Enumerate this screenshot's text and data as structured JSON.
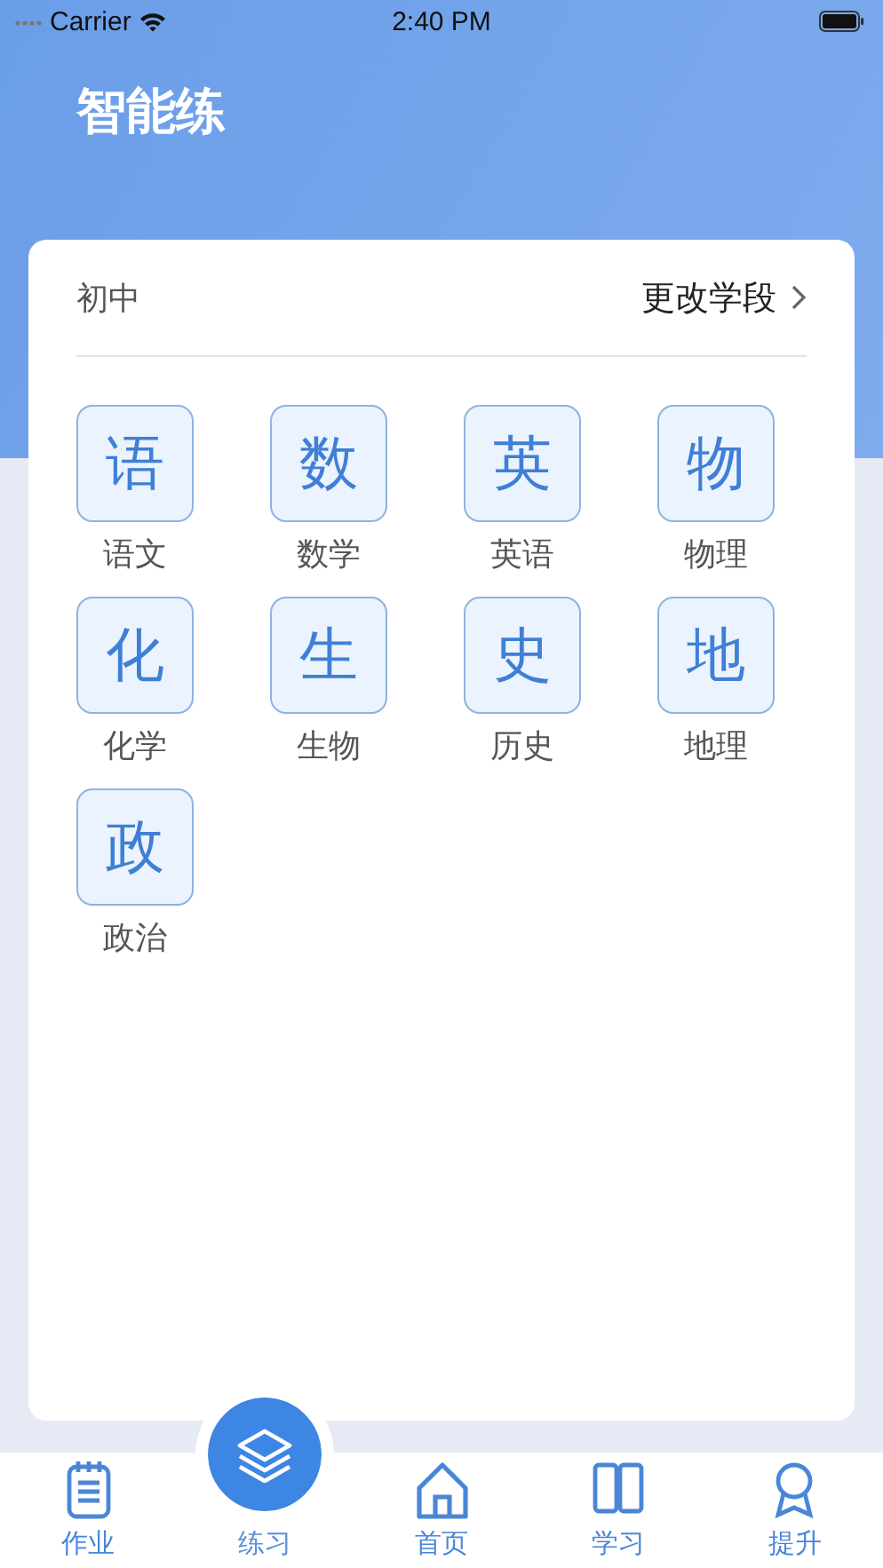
{
  "status_bar": {
    "carrier": "Carrier",
    "time": "2:40 PM"
  },
  "title": "智能练",
  "card": {
    "grade": "初中",
    "change_link": "更改学段",
    "subjects": [
      {
        "glyph": "语",
        "label": "语文"
      },
      {
        "glyph": "数",
        "label": "数学"
      },
      {
        "glyph": "英",
        "label": "英语"
      },
      {
        "glyph": "物",
        "label": "物理"
      },
      {
        "glyph": "化",
        "label": "化学"
      },
      {
        "glyph": "生",
        "label": "生物"
      },
      {
        "glyph": "史",
        "label": "历史"
      },
      {
        "glyph": "地",
        "label": "地理"
      },
      {
        "glyph": "政",
        "label": "政治"
      }
    ]
  },
  "tabs": [
    {
      "label": "作业",
      "selected": false
    },
    {
      "label": "练习",
      "selected": true
    },
    {
      "label": "首页",
      "selected": false
    },
    {
      "label": "学习",
      "selected": false
    },
    {
      "label": "提升",
      "selected": false
    }
  ]
}
